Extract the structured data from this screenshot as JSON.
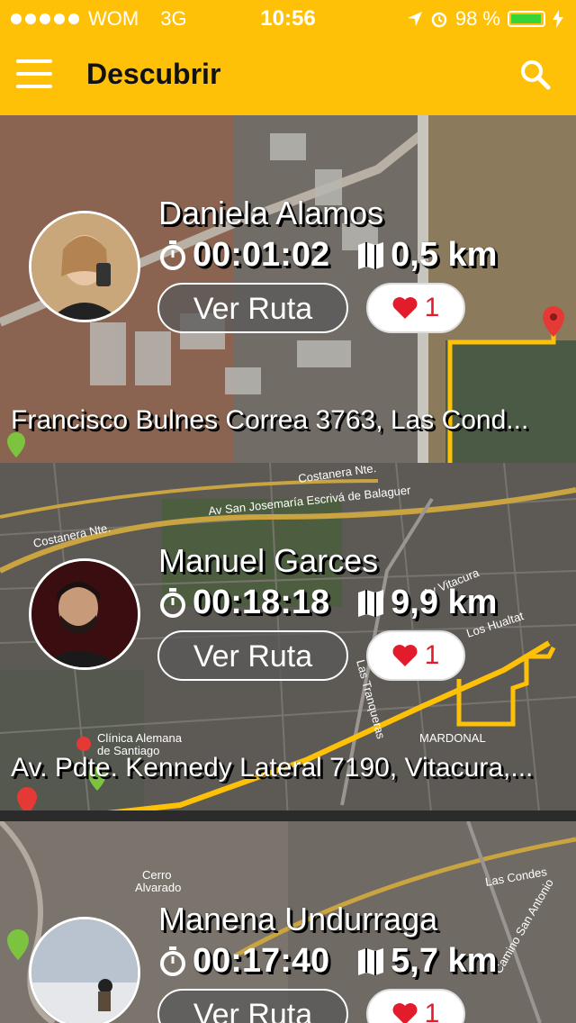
{
  "status_bar": {
    "carrier": "WOM",
    "network": "3G",
    "time": "10:56",
    "battery": "98 %",
    "battery_level": 0.98
  },
  "header": {
    "title": "Descubrir",
    "menu_icon": "hamburger-menu-icon",
    "search_icon": "search-icon"
  },
  "colors": {
    "accent": "#FFC107",
    "like_red": "#e21c2a",
    "route_line": "#FFC107"
  },
  "cards": [
    {
      "name": "Daniela Alamos",
      "time": "00:01:02",
      "distance": "0,5 km",
      "button_label": "Ver Ruta",
      "likes": "1",
      "address": "Francisco Bulnes Correa 3763, Las Cond..."
    },
    {
      "name": "Manuel Garces",
      "time": "00:18:18",
      "distance": "9,9 km",
      "button_label": "Ver Ruta",
      "likes": "1",
      "address": "Av. Pdte. Kennedy Lateral 7190, Vitacura,...",
      "map_labels": [
        "Costanera Nte.",
        "Av San Josemaría Escrivá de Balaguer",
        "Costanera Nte.",
        "Av. Vitacura",
        "Clínica Alemana de Santiago",
        "MARDONAL",
        "Las Tranqueras",
        "Los Hualtat"
      ]
    },
    {
      "name": "Manena Undurraga",
      "time": "00:17:40",
      "distance": "5,7 km",
      "button_label": "Ver Ruta",
      "likes": "1",
      "address": "",
      "map_labels": [
        "Cerro Alvarado",
        "Las Condes",
        "Camino San Antonio"
      ]
    }
  ]
}
